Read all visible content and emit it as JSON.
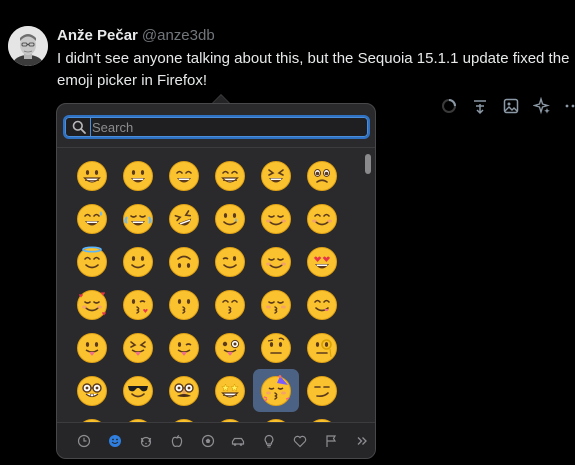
{
  "post": {
    "display_name": "Anže Pečar",
    "handle": "@anze3db",
    "text": "I didn't see anyone talking about this, but the Sequoia 15.1.1 update fixed the emoji picker in Firefox!"
  },
  "toolbar": {
    "icons": [
      "loading-spinner-icon",
      "poll-icon",
      "image-icon",
      "sparkle-icon",
      "more-icon"
    ]
  },
  "picker": {
    "search_placeholder": "Search",
    "search_value": "",
    "selected_emoji": "🥳",
    "emojis": [
      "😀",
      "😃",
      "😄",
      "😁",
      "😆",
      "🥹",
      "😅",
      "😂",
      "🤣",
      "🥲",
      "☺️",
      "😊",
      "😇",
      "🙂",
      "🙃",
      "😉",
      "😌",
      "😍",
      "🥰",
      "😘",
      "😗",
      "😙",
      "😚",
      "😋",
      "😛",
      "😝",
      "😜",
      "🤪",
      "🤨",
      "🧐",
      "🤓",
      "😎",
      "🥸",
      "🤩",
      "🥳",
      "😏",
      "😒",
      "😞",
      "😔",
      "😟",
      "😕",
      "🙁"
    ],
    "categories": [
      {
        "name": "recent",
        "icon": "clock-icon"
      },
      {
        "name": "smileys",
        "icon": "smiley-icon",
        "active": true
      },
      {
        "name": "animals",
        "icon": "dog-icon"
      },
      {
        "name": "food",
        "icon": "apple-icon"
      },
      {
        "name": "activity",
        "icon": "ball-icon"
      },
      {
        "name": "travel",
        "icon": "car-icon"
      },
      {
        "name": "objects",
        "icon": "lightbulb-icon"
      },
      {
        "name": "symbols",
        "icon": "heart-icon"
      },
      {
        "name": "flags",
        "icon": "flag-icon"
      },
      {
        "name": "more",
        "icon": "chevrons-right-icon"
      }
    ]
  }
}
